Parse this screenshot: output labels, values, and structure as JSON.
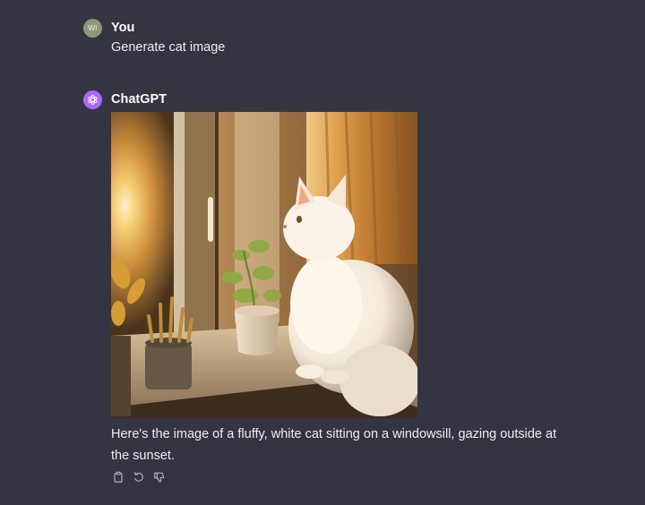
{
  "conversation": {
    "user": {
      "avatar_initials": "WI",
      "author": "You",
      "message": "Generate cat image"
    },
    "assistant": {
      "author": "ChatGPT",
      "image_description": "Fluffy white cat on a windowsill beside potted plants, gazing outside at the sunset",
      "message": "Here's the image of a fluffy, white cat sitting on a windowsill, gazing outside at the sunset."
    }
  },
  "actions": [
    {
      "icon": "copy-icon"
    },
    {
      "icon": "regenerate-icon"
    },
    {
      "icon": "thumbs-down-icon"
    }
  ],
  "colors": {
    "background": "#343541",
    "user_avatar": "#8b9a78",
    "assistant_avatar": "#ab68ff",
    "text": "#ececf1"
  }
}
